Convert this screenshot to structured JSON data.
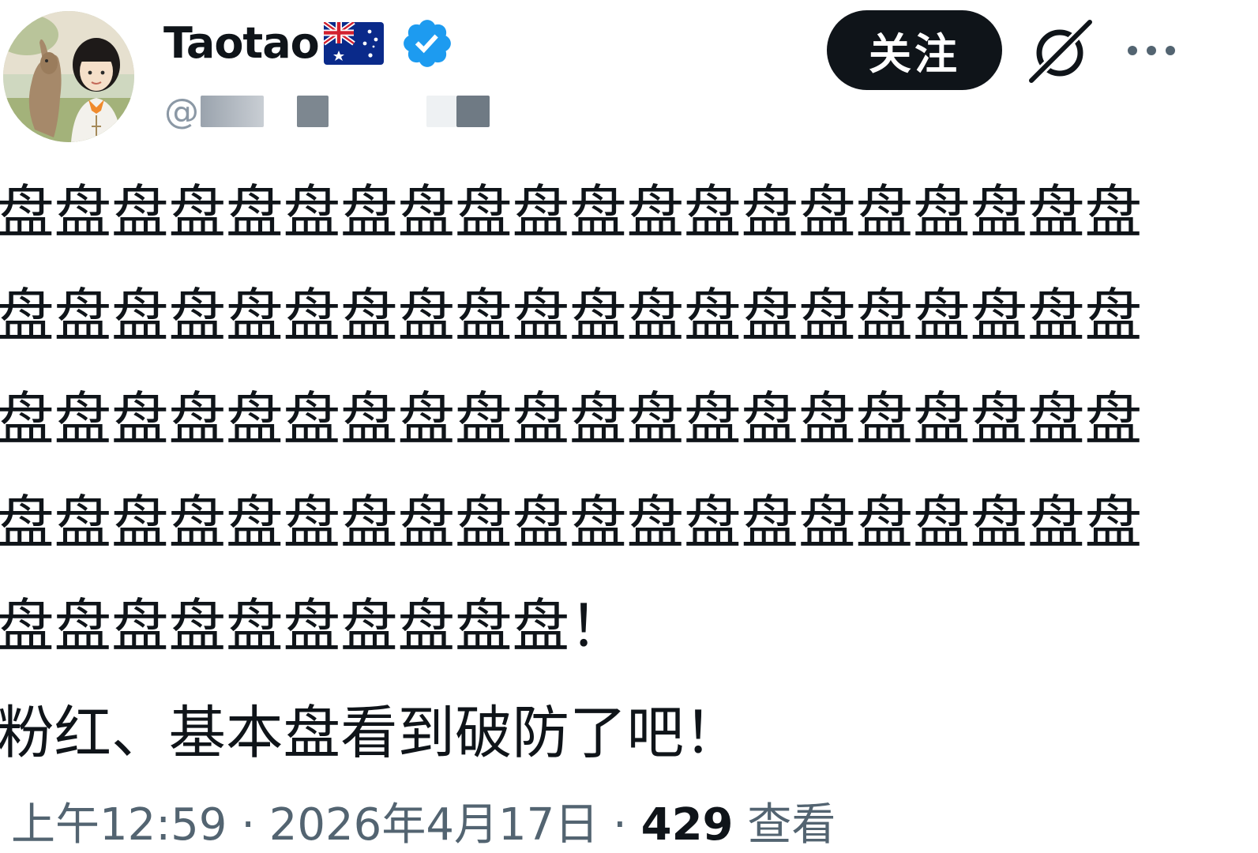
{
  "author": {
    "display_name": "Taotao",
    "handle_prefix": "@",
    "avatar_icon": "avatar-kangaroo-and-girl",
    "flag_icon": "australia-flag-icon",
    "verified_icon": "verified-badge-icon"
  },
  "actions": {
    "follow_label": "关注",
    "grok_icon": "grok-icon",
    "more_icon": "more-options-icon"
  },
  "tweet": {
    "lines": [
      "盘盘盘盘盘盘盘盘盘盘盘盘盘盘盘盘盘盘盘盘",
      "盘盘盘盘盘盘盘盘盘盘盘盘盘盘盘盘盘盘盘盘",
      "盘盘盘盘盘盘盘盘盘盘盘盘盘盘盘盘盘盘盘盘",
      "盘盘盘盘盘盘盘盘盘盘盘盘盘盘盘盘盘盘盘盘",
      "盘盘盘盘盘盘盘盘盘盘！",
      "粉红、基本盘看到破防了吧！"
    ]
  },
  "meta": {
    "time": "上午12:59",
    "separator": " · ",
    "date": "2026年4月17日",
    "views_count": "429",
    "views_label": " 查看"
  },
  "colors": {
    "text_primary": "#0f1419",
    "text_secondary": "#536471",
    "verified_blue": "#1d9bf0",
    "follow_bg": "#0f1419"
  }
}
